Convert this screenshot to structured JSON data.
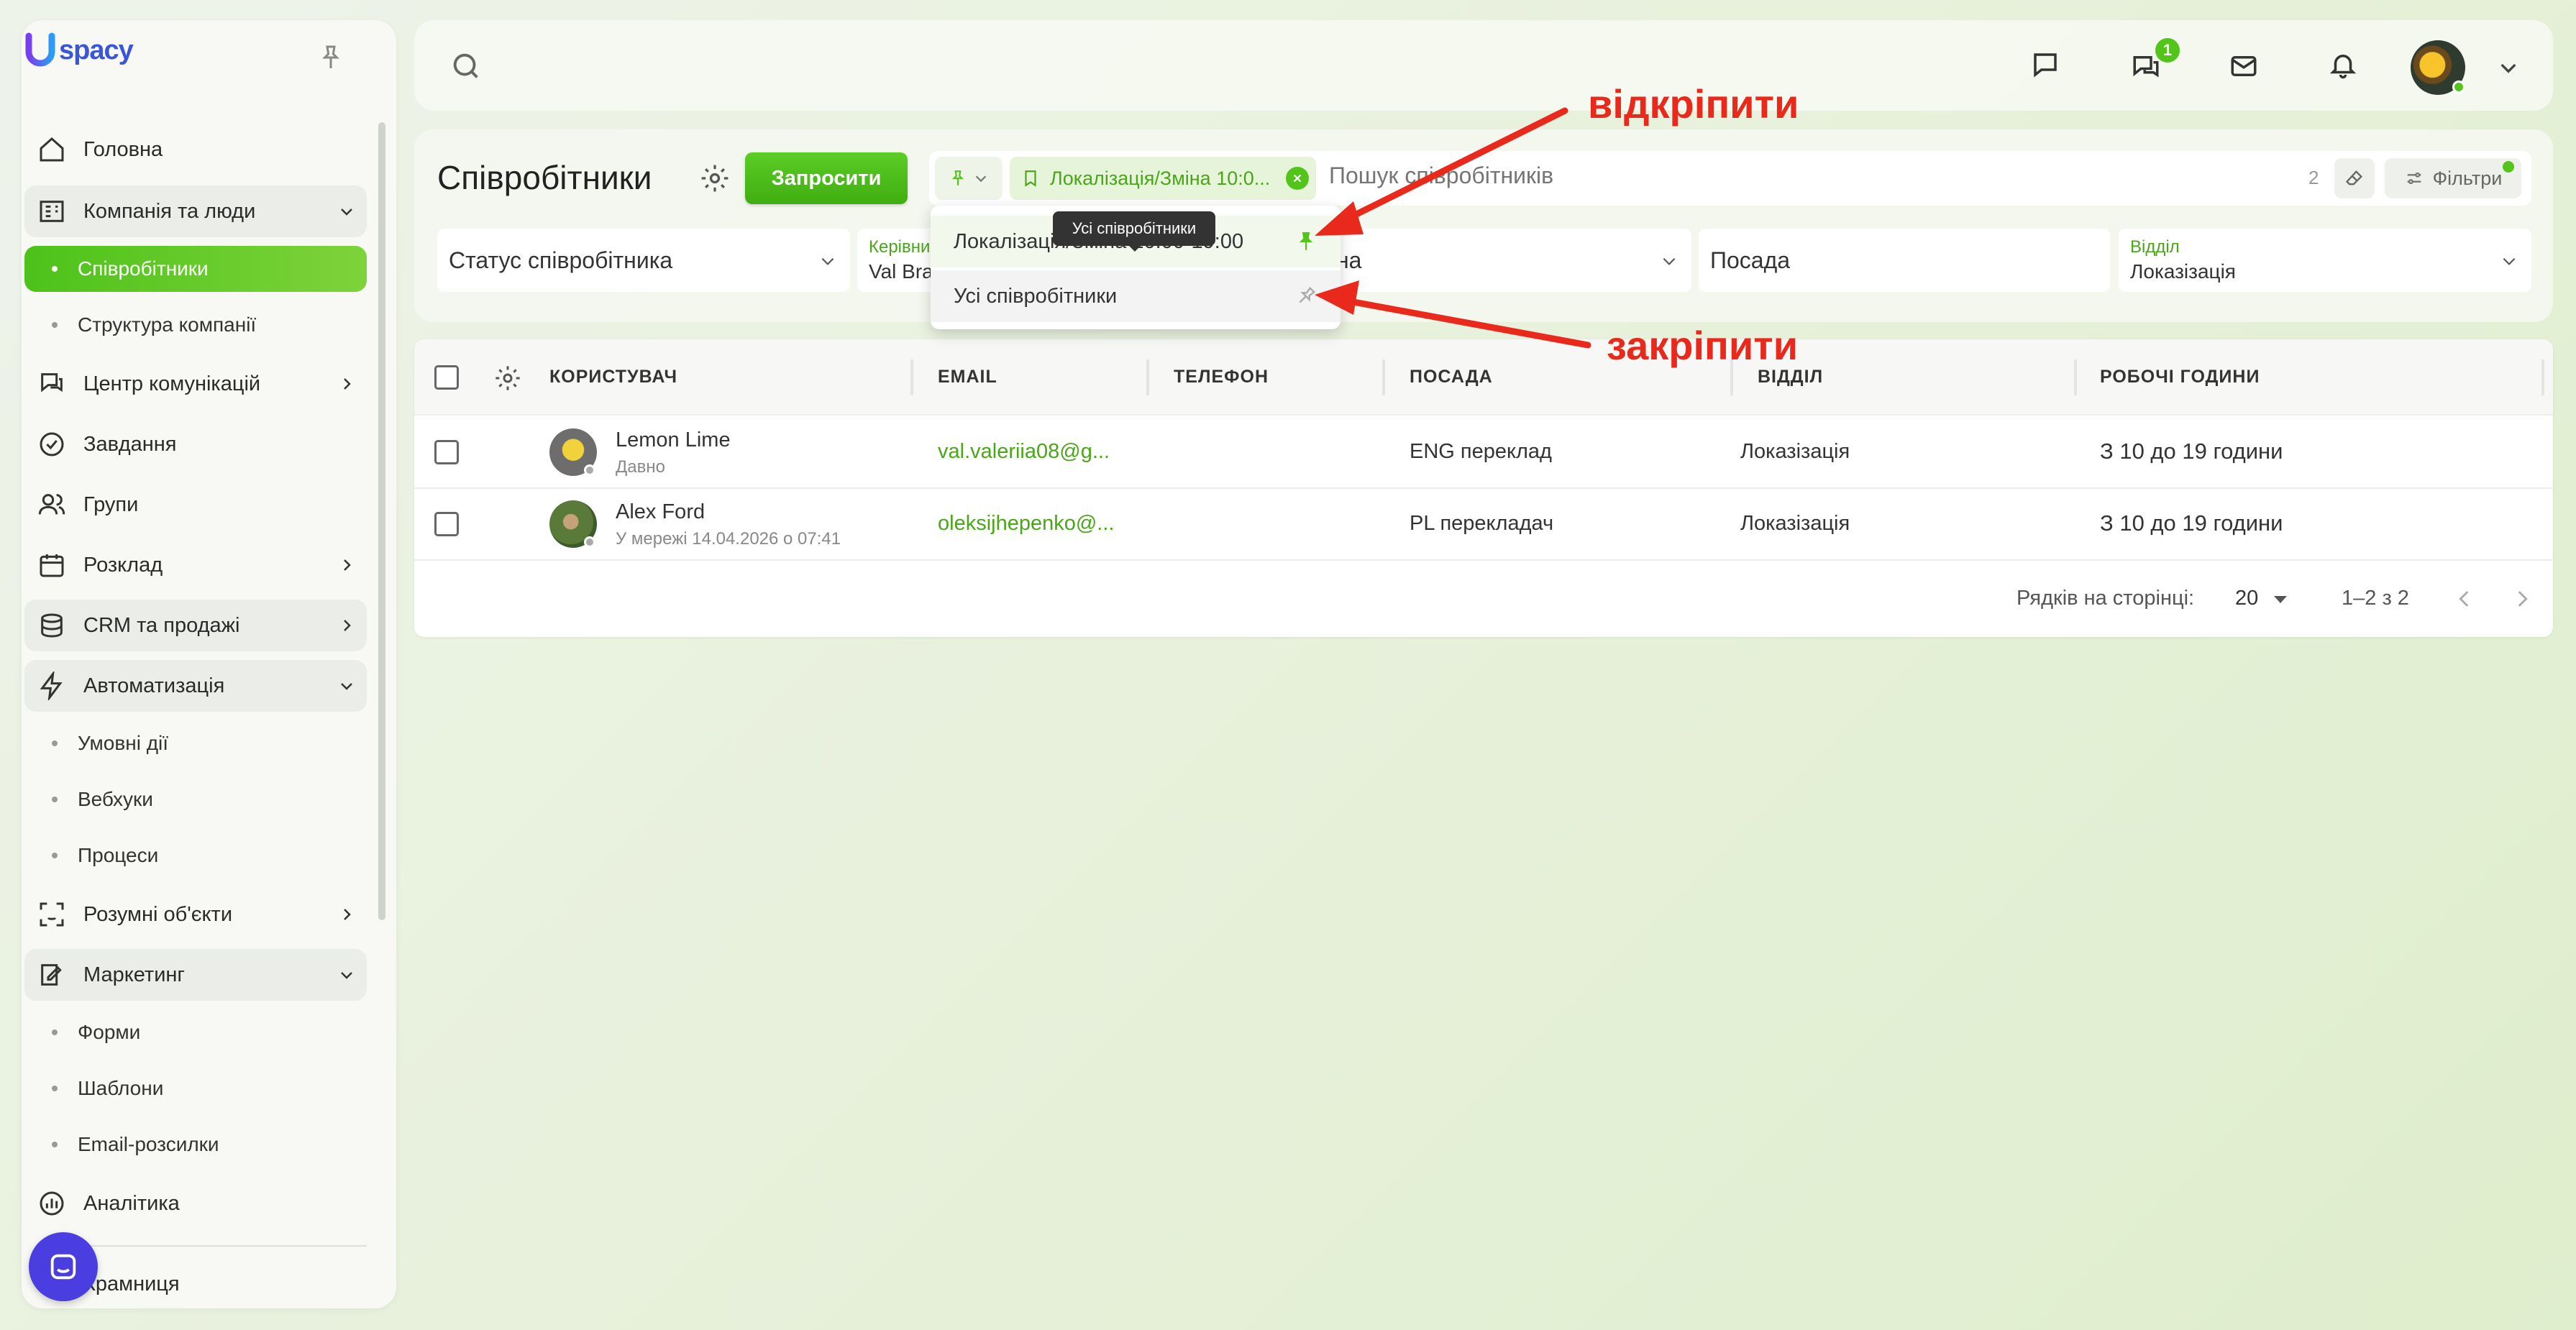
{
  "brand": {
    "logo_text": "spacy"
  },
  "sidebar": {
    "items": [
      {
        "label": "Головна",
        "icon": "home-icon"
      },
      {
        "label": "Компанія та люди",
        "icon": "company-icon",
        "expanded": true
      },
      {
        "label": "Співробітники",
        "sub": true,
        "active": true
      },
      {
        "label": "Структура компанії",
        "sub": true
      },
      {
        "label": "Центр комунікацій",
        "icon": "communication-icon"
      },
      {
        "label": "Завдання",
        "icon": "tasks-icon"
      },
      {
        "label": "Групи",
        "icon": "groups-icon"
      },
      {
        "label": "Розклад",
        "icon": "calendar-icon"
      },
      {
        "label": "CRM та продажі",
        "icon": "crm-icon"
      },
      {
        "label": "Автоматизація",
        "icon": "automation-icon",
        "expanded": true
      },
      {
        "label": "Умовні дії",
        "sub": true
      },
      {
        "label": "Вебхуки",
        "sub": true
      },
      {
        "label": "Процеси",
        "sub": true
      },
      {
        "label": "Розумні об'єкти",
        "icon": "smart-objects-icon"
      },
      {
        "label": "Маркетинг",
        "icon": "marketing-icon",
        "expanded": true
      },
      {
        "label": "Форми",
        "sub": true
      },
      {
        "label": "Шаблони",
        "sub": true
      },
      {
        "label": "Email-розсилки",
        "sub": true
      },
      {
        "label": "Аналітика",
        "icon": "analytics-icon"
      },
      {
        "label": "Крамниця",
        "icon": "shop-icon"
      }
    ]
  },
  "topbar": {
    "chat_badge": "1"
  },
  "header": {
    "title": "Співробітники",
    "invite_label": "Запросити",
    "active_filter_chip": "Локалізація/Зміна 10:0...",
    "search_placeholder": "Пошук співробітників",
    "filter_count": "2",
    "filters_label": "Фільтри"
  },
  "filters": {
    "status_placeholder": "Статус співробітника",
    "manager_label": "Керівник",
    "manager_value": "Val Bra",
    "shift_value": "на",
    "position_placeholder": "Посада",
    "department_label": "Відділ",
    "department_value": "Локазізація"
  },
  "dropdown": {
    "row1_label": "Локалізація/Зміна 10:00-19:00",
    "row2_label": "Усі співробітники",
    "tooltip": "Усі співробітники"
  },
  "table": {
    "columns": [
      "КОРИСТУВАЧ",
      "EMAIL",
      "ТЕЛЕФОН",
      "ПОСАДА",
      "ВІДДІЛ",
      "РОБОЧІ ГОДИНИ"
    ],
    "rows": [
      {
        "name": "Lemon Lime",
        "status": "Давно",
        "email": "val.valeriia08@g...",
        "phone": "",
        "position": "ENG переклад",
        "department": "Локазізація",
        "hours": "З 10 до 19 години"
      },
      {
        "name": "Alex Ford",
        "status": "У мережі 14.04.2026 о 07:41",
        "email": "oleksijhepenko@...",
        "phone": "",
        "position": "PL перекладач",
        "department": "Локазізація",
        "hours": "З 10 до 19 години"
      }
    ]
  },
  "pagination": {
    "rows_label": "Рядків на сторінці:",
    "rows_value": "20",
    "range": "1–2 з 2"
  },
  "annotations": {
    "unpin": "відкріпити",
    "pin": "закріпити"
  },
  "colors": {
    "accent": "#52c41a",
    "annotation": "#e8291c",
    "brand": "#3a56d8"
  }
}
